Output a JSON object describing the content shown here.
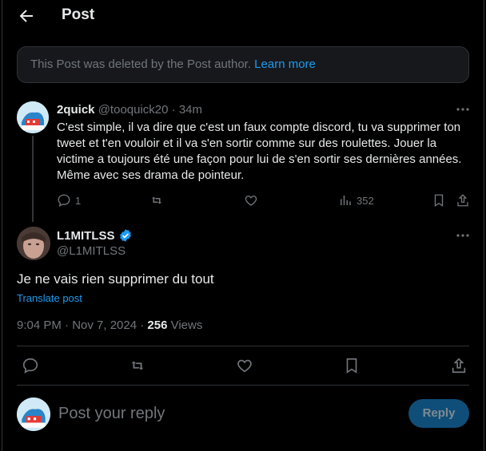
{
  "header": {
    "title": "Post"
  },
  "deleted_notice": {
    "text": "This Post was deleted by the Post author.",
    "link": "Learn more"
  },
  "reply_post": {
    "name": "2quick",
    "handle": "@tooquick20",
    "separator": "·",
    "time": "34m",
    "text": "C'est simple, il va dire que c'est un faux compte discord, tu va supprimer ton tweet et t'en vouloir et il va s'en sortir comme sur des roulettes. Jouer la victime a toujours été une façon pour lui de s'en sortir ses dernières années. Même avec ses drama de pointeur.",
    "replies": "1",
    "views": "352"
  },
  "main_post": {
    "name": "L1MITLSS",
    "handle": "@L1MITLSS",
    "text": "Je ne vais rien supprimer du tout",
    "translate": "Translate post",
    "timestamp": "9:04 PM · Nov 7, 2024 · ",
    "views_count": "256",
    "views_label": " Views"
  },
  "composer": {
    "placeholder": "Post your reply",
    "button": "Reply"
  },
  "colors": {
    "accent": "#1d9bf0",
    "muted": "#71767b",
    "background": "#000000",
    "border": "#2f3336"
  },
  "icons": [
    "back-arrow-icon",
    "more-icon",
    "reply-icon",
    "repost-icon",
    "like-icon",
    "views-icon",
    "bookmark-icon",
    "share-icon",
    "verified-badge-icon"
  ]
}
